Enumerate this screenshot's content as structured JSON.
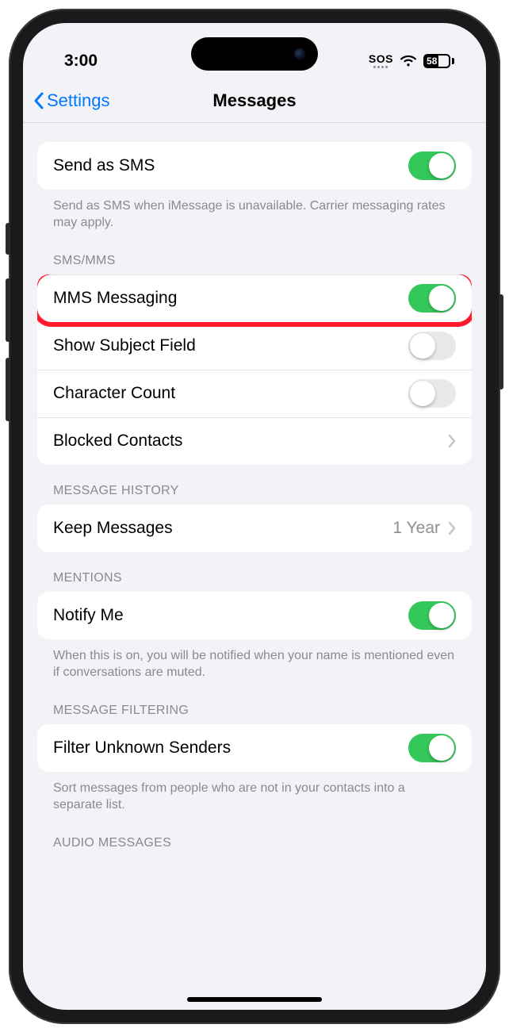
{
  "status": {
    "time": "3:00",
    "sos": "SOS",
    "battery": "58"
  },
  "nav": {
    "back": "Settings",
    "title": "Messages"
  },
  "sections": {
    "send_sms": {
      "row_label": "Send as SMS",
      "footer": "Send as SMS when iMessage is unavailable. Carrier messaging rates may apply."
    },
    "sms_mms": {
      "header": "SMS/MMS",
      "mms_label": "MMS Messaging",
      "subject_label": "Show Subject Field",
      "charcount_label": "Character Count",
      "blocked_label": "Blocked Contacts"
    },
    "history": {
      "header": "MESSAGE HISTORY",
      "keep_label": "Keep Messages",
      "keep_value": "1 Year"
    },
    "mentions": {
      "header": "MENTIONS",
      "notify_label": "Notify Me",
      "footer": "When this is on, you will be notified when your name is mentioned even if conversations are muted."
    },
    "filtering": {
      "header": "MESSAGE FILTERING",
      "filter_label": "Filter Unknown Senders",
      "footer": "Sort messages from people who are not in your contacts into a separate list."
    },
    "audio": {
      "header": "AUDIO MESSAGES"
    }
  },
  "toggles": {
    "send_sms": true,
    "mms": true,
    "subject": false,
    "charcount": false,
    "notify": true,
    "filter": true
  }
}
